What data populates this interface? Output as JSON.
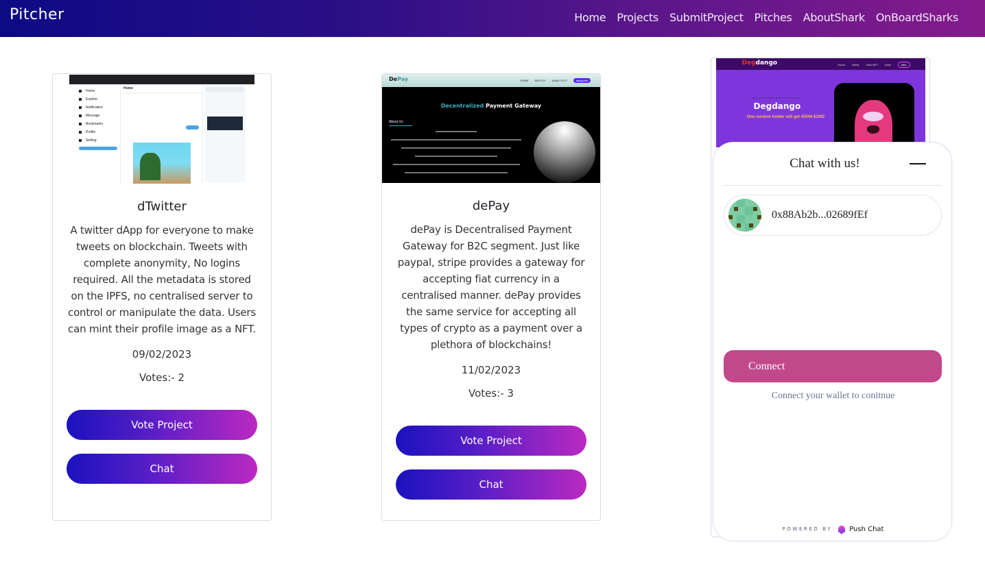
{
  "navbar": {
    "brand": "Pitcher",
    "links": [
      "Home",
      "Projects",
      "SubmitProject",
      "Pitches",
      "AboutShark",
      "OnBoardSharks"
    ]
  },
  "projects": [
    {
      "title": "dTwitter",
      "description": "A twitter dApp for everyone to make tweets on blockchain. Tweets with complete anonymity, No logins required. All the metadata is stored on the IPFS, no centralised server to control or manipulate the data. Users can mint their profile image as a NFT.",
      "date": "09/02/2023",
      "votes": "Votes:- 2",
      "vote_label": "Vote Project",
      "chat_label": "Chat",
      "thumbnail": {
        "home": "Home",
        "sidebar": [
          "Home",
          "Explore",
          "Notification",
          "Message",
          "Bookmarks",
          "Profile",
          "Setting"
        ]
      }
    },
    {
      "title": "dePay",
      "description": "dePay is Decentralised Payment Gateway for B2C segment. Just like paypal, stripe provides a gateway for accepting fiat currency in a centralised manner. dePay provides the same service for accepting all types of crypto as a payment over a plethora of blockchains!",
      "date": "11/02/2023",
      "votes": "Votes:- 3",
      "vote_label": "Vote Project",
      "chat_label": "Chat",
      "thumbnail": {
        "logo_a": "De",
        "logo_b": "Pay",
        "menu": [
          "HOME",
          "DEPLOY",
          "ANALYTICS"
        ],
        "menu_pill": "depay.eth",
        "hero_a": "Decentralized",
        "hero_b": " Payment Gateway",
        "about": "About Us"
      }
    },
    {
      "title": "Degdango",
      "thumbnail": {
        "logo_a": "Deg",
        "logo_b": "dango",
        "menu": [
          "Home",
          "Rarity",
          "View NFT",
          "Docs"
        ],
        "menu_pill": "Mint",
        "tag": "INFLATIONARY MINTING PRICE",
        "hero": "Degdango",
        "sub": "One random holder will get 45048 $ONE"
      }
    }
  ],
  "chat_widget": {
    "title": "Chat with us!",
    "address": "0x88Ab2b...02689fEf",
    "connect_label": "Connect",
    "connect_hint": "Connect your wallet to conitnue",
    "powered_by": "POWERED BY",
    "brand": "Push Chat",
    "accent_color": "#c2488c"
  }
}
